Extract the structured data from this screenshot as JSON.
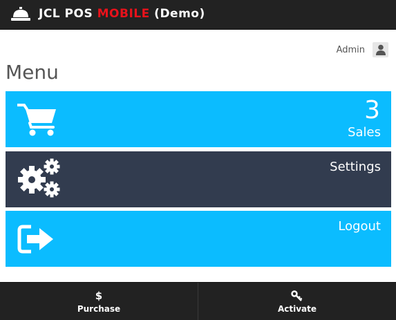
{
  "header": {
    "brand_prefix": "JCL POS ",
    "brand_accent": "MOBILE",
    "brand_suffix": " (Demo)",
    "brand_icon": "service-bell-icon"
  },
  "user": {
    "name": "Admin",
    "icon": "user-icon"
  },
  "page": {
    "title": "Menu"
  },
  "tiles": [
    {
      "label": "Sales",
      "count": "3",
      "icon": "cart-icon",
      "color": "#0bbcff"
    },
    {
      "label": "Settings",
      "icon": "gears-icon",
      "color": "#323c4f"
    },
    {
      "label": "Logout",
      "icon": "logout-icon",
      "color": "#0bbcff"
    }
  ],
  "footer": {
    "buttons": [
      {
        "label": "Purchase",
        "icon_text": "$",
        "icon": "dollar-icon"
      },
      {
        "label": "Activate",
        "icon": "key-icon"
      }
    ]
  },
  "colors": {
    "bar": "#222222",
    "accent_red": "#e8121b",
    "tile_blue": "#0bbcff",
    "tile_dark": "#323c4f"
  }
}
